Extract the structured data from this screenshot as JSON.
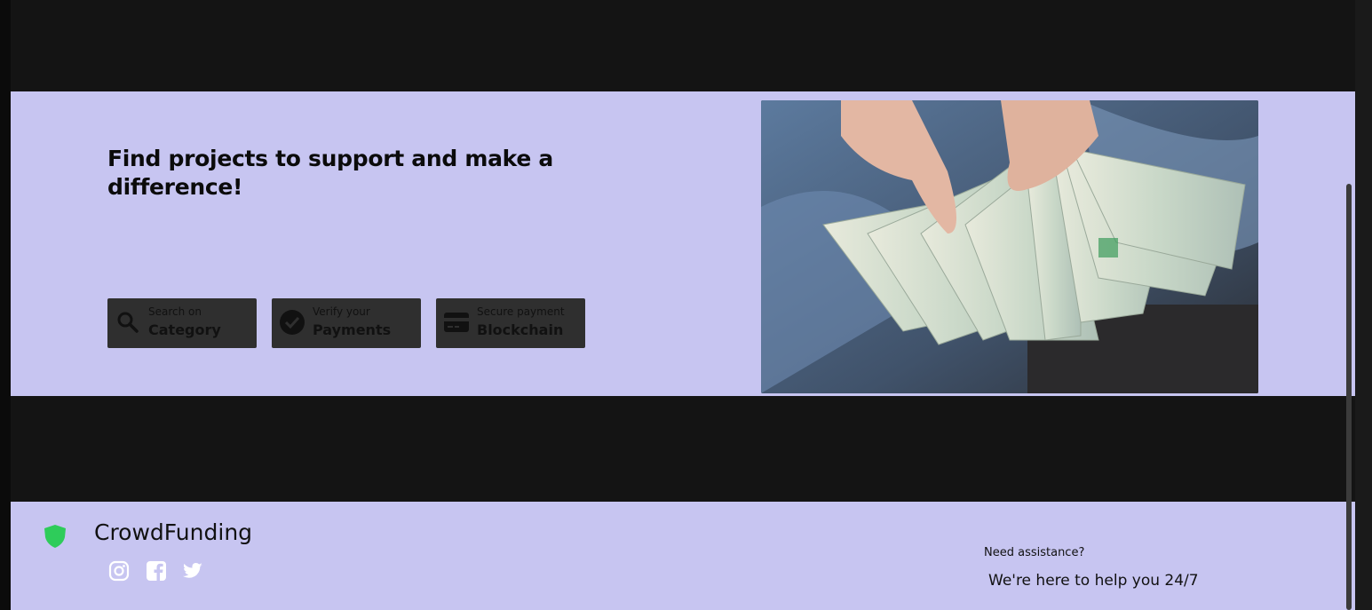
{
  "hero": {
    "title": "Find projects to support and make a difference!",
    "features": [
      {
        "icon": "search-icon",
        "small": "Search on",
        "big": "Category"
      },
      {
        "icon": "check-circle-icon",
        "small": "Verify your",
        "big": "Payments"
      },
      {
        "icon": "credit-card-icon",
        "small": "Secure payment",
        "big": "Blockchain"
      }
    ],
    "image_alt": "hands-holding-dollar-bills"
  },
  "footer": {
    "brand": "CrowdFunding",
    "brand_color": "#2ecc5a",
    "social": [
      "instagram-icon",
      "facebook-icon",
      "twitter-icon"
    ],
    "assist_small": "Need assistance?",
    "assist_big": "We're here to help you 24/7"
  },
  "colors": {
    "panel_bg": "#c7c5f1",
    "page_bg": "#141414",
    "feature_bg": "#2f2f2f"
  }
}
